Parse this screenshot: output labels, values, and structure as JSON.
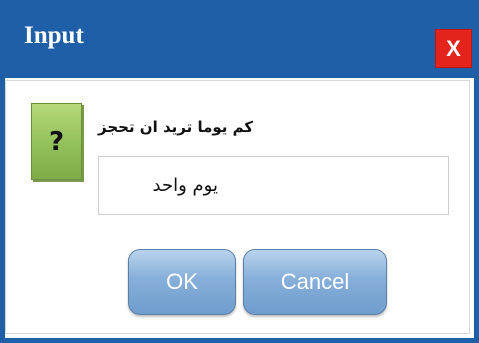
{
  "window": {
    "title": "Input",
    "close_label": "X"
  },
  "dialog": {
    "icon_glyph": "?",
    "icon_name": "question-icon",
    "prompt": "كم يوما تريد ان تحجز",
    "input_value": "يوم واحد"
  },
  "buttons": {
    "ok_label": "OK",
    "cancel_label": "Cancel"
  },
  "colors": {
    "title_bar": "#1f5fa8",
    "close_button": "#e3231c",
    "icon": "#92c05a",
    "button": "#86afd9"
  }
}
